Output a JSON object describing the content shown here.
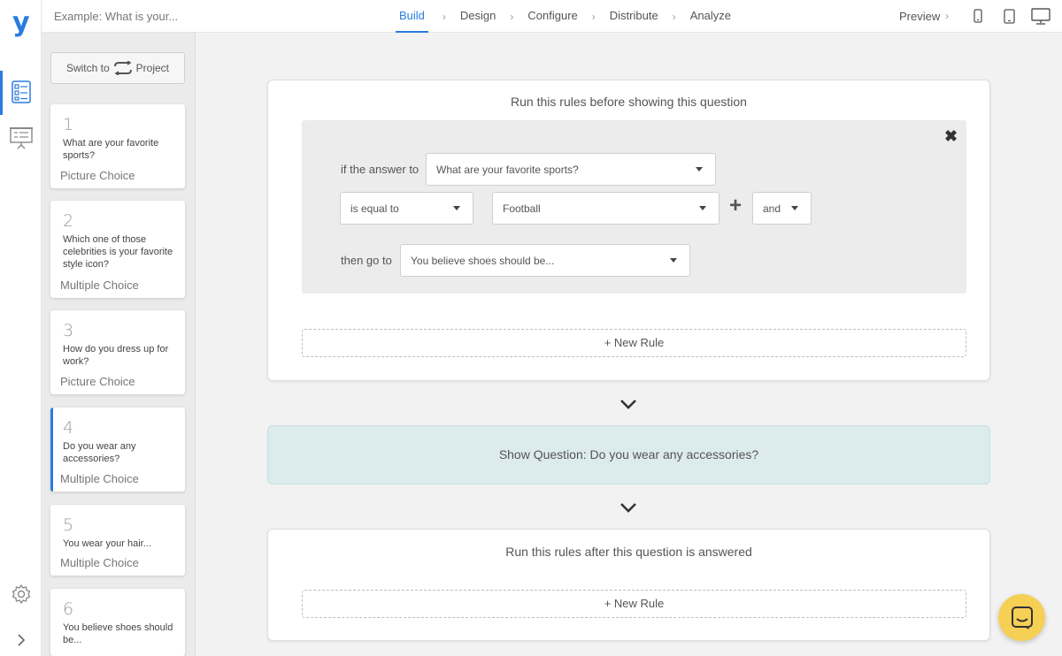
{
  "brand": {
    "logo_letter": "y",
    "accent": "#2a7be0"
  },
  "topbar": {
    "title": "Example: What is your...",
    "steps": [
      {
        "label": "Build",
        "active": true
      },
      {
        "label": "Design",
        "active": false
      },
      {
        "label": "Configure",
        "active": false
      },
      {
        "label": "Distribute",
        "active": false
      },
      {
        "label": "Analyze",
        "active": false
      }
    ],
    "preview_label": "Preview",
    "devices": [
      "phone-icon",
      "tablet-icon",
      "desktop-icon"
    ]
  },
  "sidebar": {
    "switch_prefix": "Switch to",
    "switch_suffix": "Project",
    "questions": [
      {
        "number": "1",
        "text": "What are your favorite sports?",
        "type": "Picture Choice"
      },
      {
        "number": "2",
        "text": "Which one of those celebrities is your favorite style icon?",
        "type": "Multiple Choice"
      },
      {
        "number": "3",
        "text": "How do you dress up for work?",
        "type": "Picture Choice"
      },
      {
        "number": "4",
        "text": "Do you wear any accessories?",
        "type": "Multiple Choice",
        "active": true
      },
      {
        "number": "5",
        "text": "You wear your hair...",
        "type": "Multiple Choice"
      },
      {
        "number": "6",
        "text": "You believe shoes should be...",
        "type": ""
      }
    ]
  },
  "before_rules": {
    "title": "Run this rules before showing this question",
    "if_label": "if the answer to",
    "question_select": "What are your favorite sports?",
    "operator_select": "is equal to",
    "value_select": "Football",
    "conjunction_select": "and",
    "then_label": "then go to",
    "target_select": "You believe shoes should be...",
    "new_rule_label": "+ New Rule"
  },
  "show_question": {
    "label": "Show Question: Do you wear any accessories?"
  },
  "after_rules": {
    "title": "Run this rules after this question is answered",
    "new_rule_label": "+ New Rule"
  },
  "colors": {
    "show_question_bg": "#dcebec",
    "chat_button": "#f6cf55"
  }
}
